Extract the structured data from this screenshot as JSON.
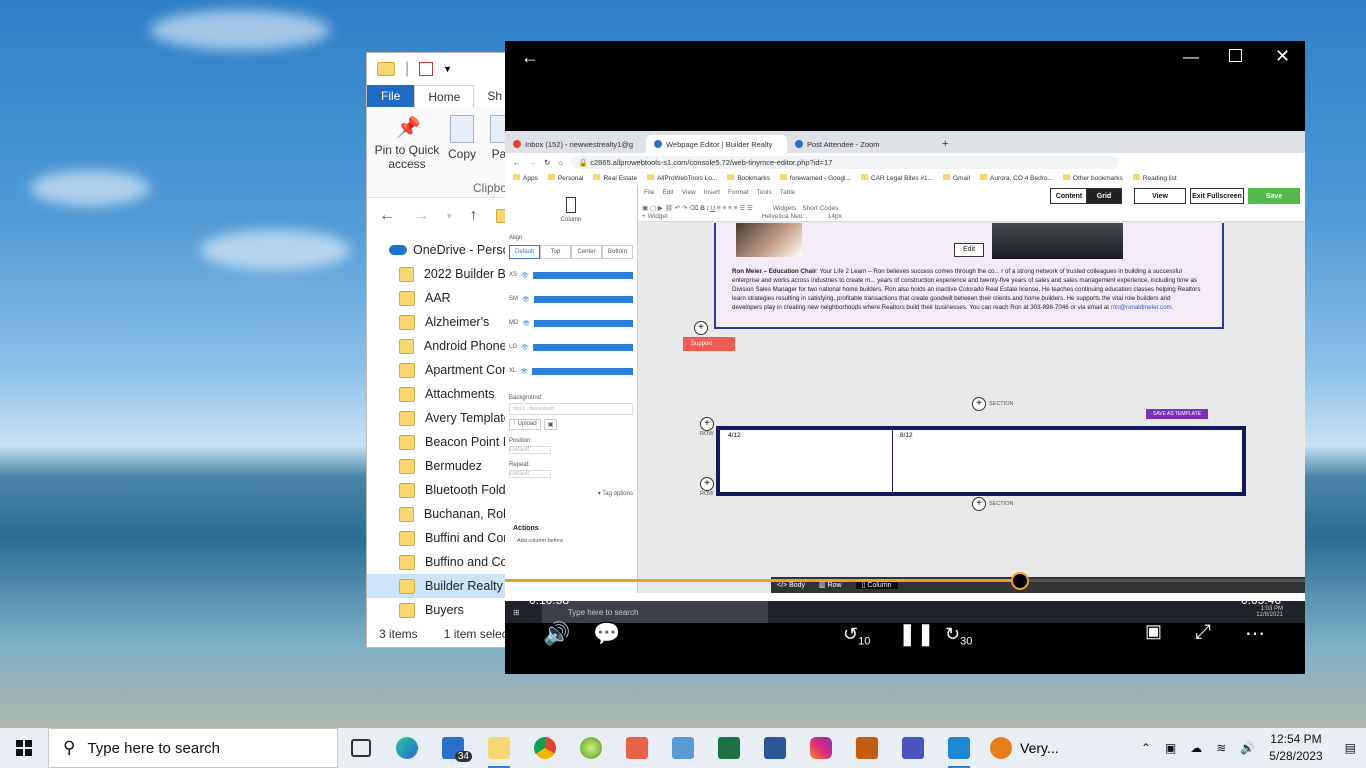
{
  "explorer": {
    "tabs": {
      "file": "File",
      "home": "Home",
      "share": "Sh"
    },
    "ribbon": {
      "pin": "Pin to Quick access",
      "copy": "Copy",
      "paste": "Pas",
      "clipboard": "Clipbo"
    },
    "onedrive": "OneDrive - Person",
    "folders": [
      "2022 Builder Bre",
      "AAR",
      "Alzheimer's",
      "Android Phone 2",
      "Apartment Com",
      "Attachments",
      "Avery Templates",
      "Beacon Point M",
      "Bermudez",
      "Bluetooth Folde",
      "Buchanan, Robe",
      "Buffini and Com",
      "Buffino and Co",
      "Builder Realty C",
      "Buyers"
    ],
    "selected_index": 13,
    "status": {
      "items": "3 items",
      "selected": "1 item select"
    }
  },
  "browser": {
    "tabs": [
      {
        "label": "Inbox (152) - newwestrealty1@g"
      },
      {
        "label": "Webpage Editor | Builder Realty"
      },
      {
        "label": "Post Attendee - Zoom"
      }
    ],
    "url": "c2865.allprowebtools-s1.com/console5.72/web-tinymce-editor.php?id=17",
    "bookmarks": [
      "Apps",
      "Personal",
      "Real Estate",
      "AllProWebTools Lo...",
      "Bookmarks",
      "forewarned - Googl...",
      "CAR Legal Bites #1...",
      "Gmail",
      "Aurora, CO 4 Bedro...",
      "Other bookmarks",
      "Reading list"
    ]
  },
  "editor": {
    "panel": {
      "column_label": "Column",
      "align_label": "Align",
      "align_options": [
        "Default",
        "Top",
        "Center",
        "Bottom"
      ],
      "breakpoints": [
        "XS",
        "SM",
        "MD",
        "LG",
        "XL"
      ],
      "background_label": "Background:",
      "background_placeholder": "http://...file/url/path",
      "upload": "Upload",
      "position_label": "Position:",
      "position_value": "Default",
      "repeat_label": "Repeat:",
      "repeat_value": "Default",
      "tag_options": "Tag options",
      "actions": "Actions",
      "add_column": "Add column before"
    },
    "menu": [
      "File",
      "Edit",
      "View",
      "Insert",
      "Format",
      "Tools",
      "Table"
    ],
    "toolbar": {
      "content": "Content",
      "grid": "Grid",
      "view": "View",
      "exit": "Exit Fullscreen",
      "save": "Save",
      "widget": "Widget",
      "font": "Helvetica Neu...",
      "size": "14px",
      "widgets": "Widgets",
      "short_codes": "Short Codes"
    },
    "edit": "Edit",
    "bio": {
      "name": "Ron Meier – Education Chair",
      "text": "Your Life 2 Learn – Ron believes success comes through the co... r of a strong network of trusted colleagues in building a successful enterprise and works across industries to create m... years of construction experience and twenty-five years of sales and sales management experience, including time as Division Sales Manager for two national home builders. Ron also holds an inactive Colorado Real Estate license. He teaches continuing education classes helping Realtors learn strategies resulting in satisfying, profitable transactions that create goodwill between their clients and home builders. He supports the vital role builders and developers play in creating new neighborhoods where Realtors build their businesses. You can reach Ron at 303-898-7046 or via email at ",
      "email": "ron@ronaldmeier.com."
    },
    "support": "Support",
    "section": "SECTION",
    "row": "ROW",
    "save_template": "SAVE AS TEMPLATE",
    "grid_cells": [
      "4/12",
      "8/12"
    ],
    "breadcrumb": [
      "Body",
      "Row",
      "Column"
    ],
    "inner_search": "Type here to search",
    "inner_time": "1:03 PM",
    "inner_date": "12/8/2021"
  },
  "player": {
    "elapsed": "0:10:58",
    "remaining": "0:05:46",
    "progress": 0.643,
    "skip_back": "10",
    "skip_forward": "30"
  },
  "taskbar": {
    "search_placeholder": "Type here to search",
    "mail_badge": "34",
    "weather": "Very...",
    "time": "12:54 PM",
    "date": "5/28/2023"
  }
}
